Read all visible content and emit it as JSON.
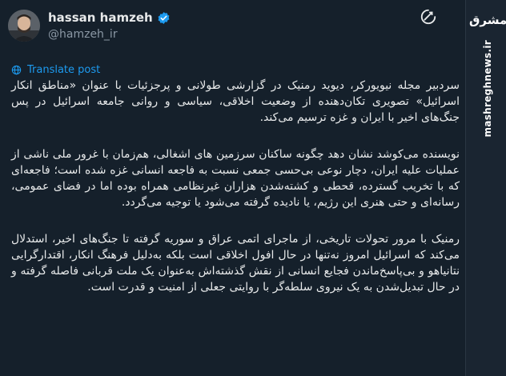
{
  "author": {
    "display_name": "hassan hamzeh",
    "handle": "@hamzeh_ir",
    "verified": true
  },
  "translate_label": "Translate post",
  "watermark": {
    "logo_text": "مشرق",
    "site_url": "mashreghnews.ir"
  },
  "icons": [
    "grok-icon",
    "verified-badge-icon",
    "globe-icon"
  ],
  "colors": {
    "background": "#15202b",
    "accent": "#1d9bf0",
    "text": "#e7e9ea",
    "secondary_text": "#8b98a5"
  },
  "paragraphs": [
    "سردبیر مجله نیویورکر، دیوید رمنیک در گزارشی طولانی و پرجزئیات با عنوان «مناطق انکار اسرائیل» تصویری تکان‌دهنده از وضعیت اخلاقی، سیاسی و روانی جامعه اسرائیل در پس جنگ‌های اخیر با ایران و غزه ترسیم می‌کند.",
    "نویسنده می‌کوشد نشان دهد چگونه ساکنان سرزمین های اشغالی، هم‌زمان با غرور ملی ناشی از عملیات علیه ایران، دچار نوعی بی‌حسی جمعی نسبت به فاجعه انسانی غزه شده است؛ فاجعه‌ای که با تخریب گسترده، قحطی و کشته‌شدن هزاران غیرنظامی همراه بوده اما در فضای عمومی، رسانه‌ای و حتی هنری این رژیم، یا نادیده گرفته می‌شود یا توجیه می‌گردد.",
    "رمنیک با مرور تحولات تاریخی، از ماجرای اتمی عراق و سوریه گرفته تا جنگ‌های اخیر، استدلال می‌کند که اسرائیل امروز نه‌تنها در حال افول اخلاقی است بلکه به‌دلیل فرهنگ انکار، اقتدارگرایی نتانیاهو و بی‌پاسخ‌ماندن فجایع انسانی از نقش گذشته‌اش به‌عنوان یک ملت قربانی فاصله گرفته و در حال تبدیل‌شدن به یک نیروی سلطه‌گر با روایتی جعلی از امنیت و قدرت است."
  ]
}
